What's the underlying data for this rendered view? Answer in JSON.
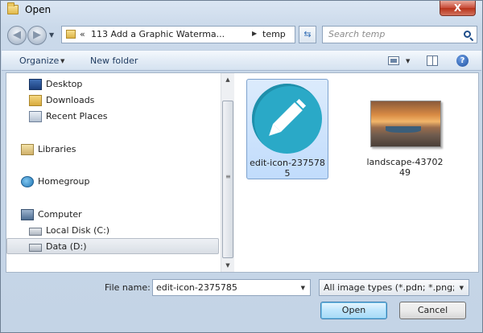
{
  "window": {
    "title": "Open",
    "close_label": "X"
  },
  "address": {
    "chevron": "«",
    "crumbs": [
      "113 Add a Graphic Waterma...",
      "temp"
    ],
    "search_placeholder": "Search temp"
  },
  "toolbar": {
    "organize_label": "Organize",
    "new_folder_label": "New folder",
    "help_label": "?"
  },
  "nav": {
    "favorites": [
      {
        "label": "Desktop",
        "icon": "desktop-icon"
      },
      {
        "label": "Downloads",
        "icon": "downloads-folder-icon"
      },
      {
        "label": "Recent Places",
        "icon": "recent-places-icon"
      }
    ],
    "libraries": {
      "label": "Libraries",
      "icon": "libraries-icon"
    },
    "homegroup": {
      "label": "Homegroup",
      "icon": "homegroup-icon"
    },
    "computer": {
      "label": "Computer",
      "icon": "computer-icon"
    },
    "drives": [
      {
        "label": "Local Disk (C:)",
        "icon": "local-disk-icon",
        "selected": false
      },
      {
        "label": "Data (D:)",
        "icon": "data-drive-icon",
        "selected": true
      }
    ]
  },
  "files": [
    {
      "name_line1": "edit-icon-237578",
      "name_line2": "5",
      "thumb": "edit-pencil-icon",
      "selected": true
    },
    {
      "name_line1": "landscape-43702",
      "name_line2": "49",
      "thumb": "landscape-photo",
      "selected": false
    }
  ],
  "bottom": {
    "file_name_label": "File name:",
    "file_name_value": "edit-icon-2375785",
    "file_type_value": "All image types (*.pdn; *.png; *",
    "open_label": "Open",
    "cancel_label": "Cancel"
  },
  "colors": {
    "accent_icon": "#2aa9c7",
    "selection": "#c1dcfc"
  }
}
